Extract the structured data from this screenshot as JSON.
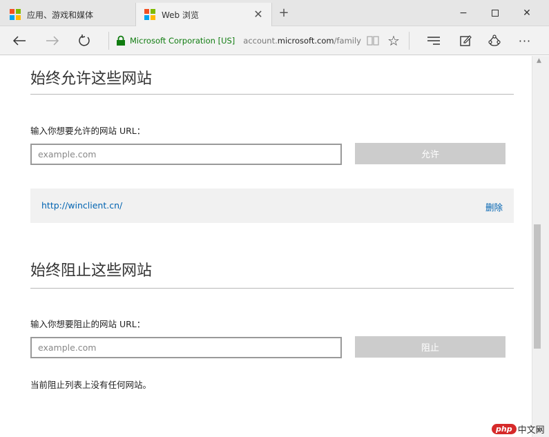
{
  "browser": {
    "tabs": [
      {
        "label": "应用、游戏和媒体"
      },
      {
        "label": "Web 浏览"
      }
    ],
    "new_tab_symbol": "+",
    "close_tab_symbol": "✕",
    "window_controls": {
      "minimize": "−",
      "close": "✕"
    },
    "nav": {
      "back": "←",
      "forward": "→",
      "refresh": "↻"
    },
    "address": {
      "identity": "Microsoft Corporation [US]",
      "url_prefix": "account.",
      "url_domain": "microsoft.com",
      "url_path": "/family"
    },
    "toolbar": {
      "favorite": "☆",
      "more": "···"
    },
    "icons": [
      "back-icon",
      "forward-icon",
      "refresh-icon",
      "lock-icon",
      "reading-view-icon",
      "favorite-icon",
      "hub-icon",
      "web-note-icon",
      "share-icon",
      "more-icon"
    ]
  },
  "allow_section": {
    "title": "始终允许这些网站",
    "input_label": "输入你想要允许的网站 URL：",
    "input_placeholder": "example.com",
    "button_label": "允许",
    "sites": [
      {
        "url": "http://winclient.cn/",
        "remove_label": "删除"
      }
    ]
  },
  "block_section": {
    "title": "始终阻止这些网站",
    "input_label": "输入你想要阻止的网站 URL：",
    "input_placeholder": "example.com",
    "button_label": "阻止",
    "empty_message": "当前阻止列表上没有任何网站。"
  },
  "watermark": {
    "badge": "php",
    "text": "中文网"
  },
  "colors": {
    "ms_red": "#f25022",
    "ms_green": "#7fba00",
    "ms_blue": "#00a4ef",
    "ms_yellow": "#ffb900",
    "link": "#0063b1",
    "secure": "#107c10",
    "disabled_button": "#cccccc"
  }
}
